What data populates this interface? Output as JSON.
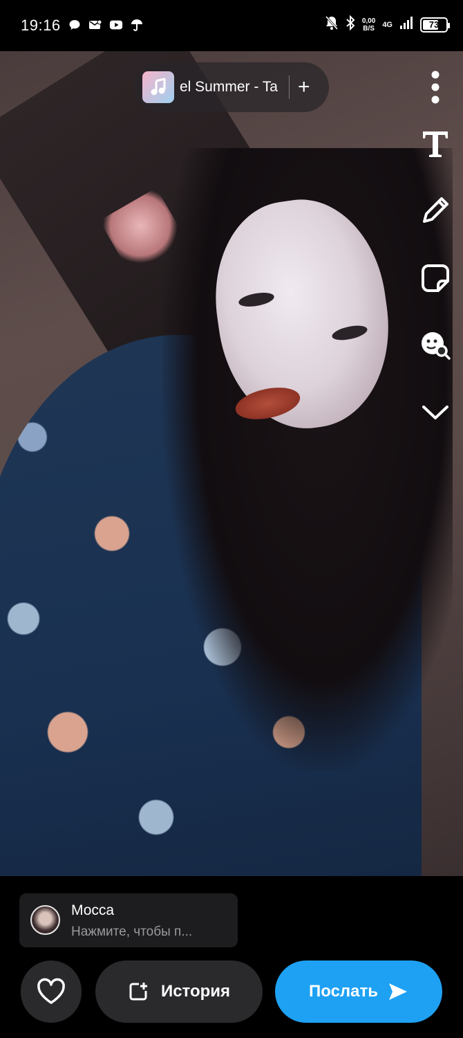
{
  "status_bar": {
    "time": "19:16",
    "net_speed_value": "0,00",
    "net_speed_unit": "B/S",
    "net_type": "4G",
    "battery": "73"
  },
  "music": {
    "title": "el Summer - Ta"
  },
  "reply": {
    "name": "Мосса",
    "hint": "Нажмите, чтобы п..."
  },
  "actions": {
    "story_label": "История",
    "send_label": "Послать"
  },
  "colors": {
    "send_button": "#1ea1f3",
    "secondary_button": "#2a2a2c"
  },
  "icons": {
    "left_status": [
      "chat-bubble-icon",
      "mail-icon",
      "youtube-icon",
      "umbrella-icon"
    ],
    "right_status": [
      "mute-bell-icon",
      "bluetooth-icon",
      "signal-icon",
      "battery-icon"
    ],
    "tools": [
      "more-vertical-icon",
      "text-icon",
      "pencil-icon",
      "sticker-icon",
      "lens-search-icon",
      "chevron-down-icon"
    ]
  }
}
